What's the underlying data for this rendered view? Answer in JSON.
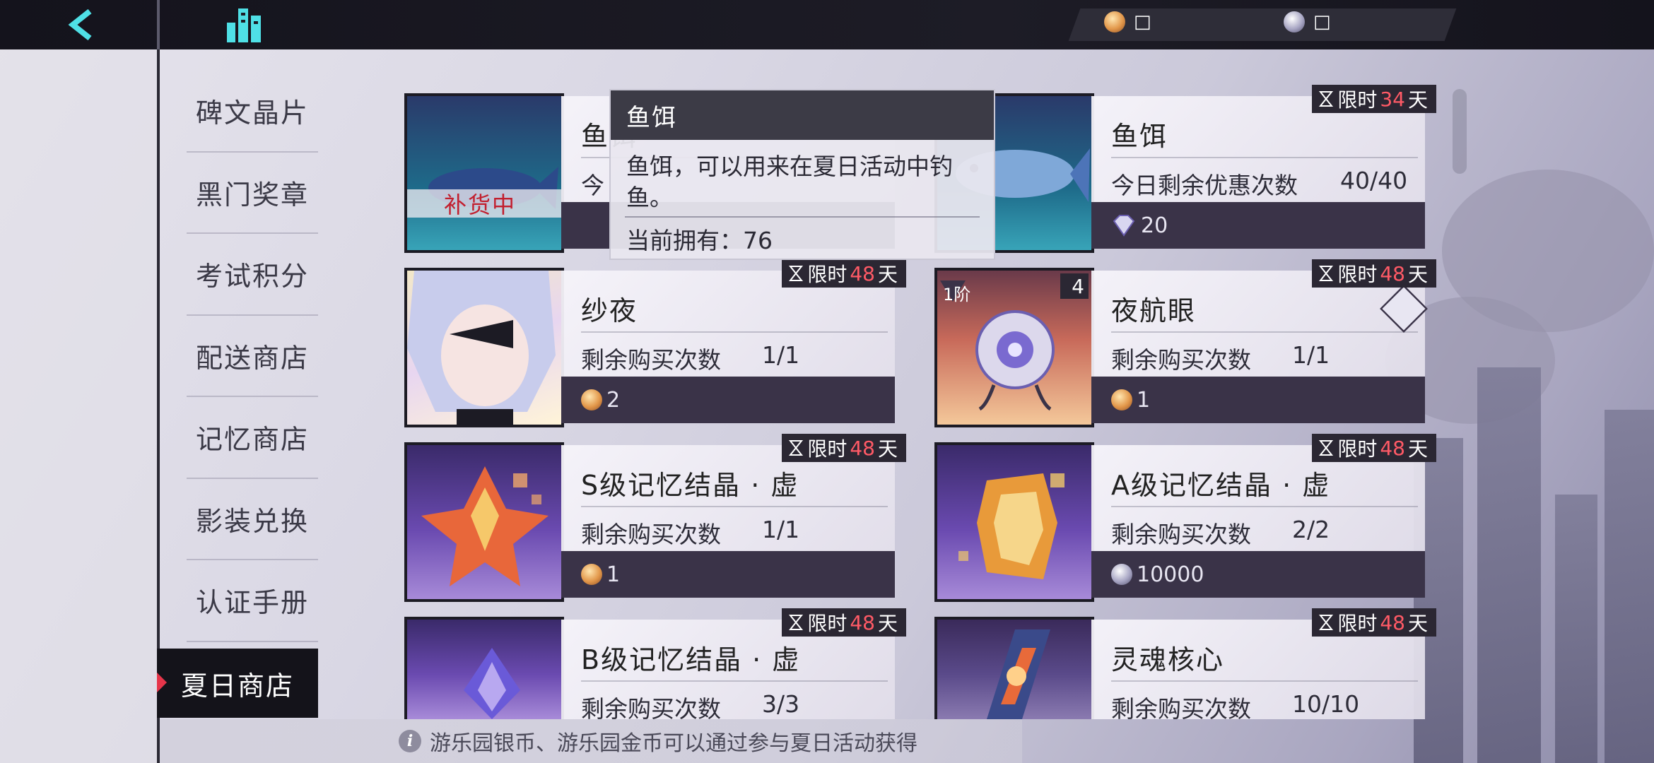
{
  "header": {
    "back_icon": "chevron-left-icon",
    "home_icon": "city-buildings-icon",
    "currencies": [
      {
        "icon": "gold-coin-icon",
        "value": "□"
      },
      {
        "icon": "silver-coin-icon",
        "value": "□"
      }
    ]
  },
  "sidebar": {
    "items": [
      {
        "label": "碑文晶片"
      },
      {
        "label": "黑门奖章"
      },
      {
        "label": "考试积分"
      },
      {
        "label": "配送商店"
      },
      {
        "label": "记忆商店"
      },
      {
        "label": "影装兑换"
      },
      {
        "label": "认证手册"
      }
    ],
    "active": {
      "label": "夏日商店"
    }
  },
  "cards": [
    {
      "name": "鱼饵",
      "remain_label": "今",
      "restock": "补货中"
    },
    {
      "name": "鱼饵",
      "remain_label": "今日剩余优惠次数",
      "remain_count": "40/40",
      "price": "20",
      "currency": "diamond",
      "limit_label": "限时",
      "limit_num": "34",
      "limit_unit": "天"
    },
    {
      "name": "纱夜",
      "remain_label": "剩余购买次数",
      "remain_count": "1/1",
      "price": "2",
      "currency": "gold",
      "limit_label": "限时",
      "limit_num": "48",
      "limit_unit": "天"
    },
    {
      "name": "夜航眼",
      "remain_label": "剩余购买次数",
      "remain_count": "1/1",
      "price": "1",
      "currency": "gold",
      "limit_label": "限时",
      "limit_num": "48",
      "limit_unit": "天",
      "badge_rank": "1阶",
      "badge_count": "4"
    },
    {
      "name": "S级记忆结晶 · 虚",
      "remain_label": "剩余购买次数",
      "remain_count": "1/1",
      "price": "1",
      "currency": "gold",
      "limit_label": "限时",
      "limit_num": "48",
      "limit_unit": "天"
    },
    {
      "name": "A级记忆结晶 · 虚",
      "remain_label": "剩余购买次数",
      "remain_count": "2/2",
      "price": "10000",
      "currency": "silver",
      "limit_label": "限时",
      "limit_num": "48",
      "limit_unit": "天"
    },
    {
      "name": "B级记忆结晶 · 虚",
      "remain_label": "剩余购买次数",
      "remain_count": "3/3",
      "limit_label": "限时",
      "limit_num": "48",
      "limit_unit": "天"
    },
    {
      "name": "灵魂核心",
      "remain_label": "剩余购买次数",
      "remain_count": "10/10",
      "limit_label": "限时",
      "limit_num": "48",
      "limit_unit": "天"
    }
  ],
  "tooltip": {
    "title": "鱼饵",
    "description": "鱼饵，可以用来在夏日活动中钓鱼。",
    "owned": "当前拥有：76"
  },
  "footer": {
    "info_icon": "info-icon",
    "text": "游乐园银币、游乐园金币可以通过参与夏日活动获得"
  },
  "colors": {
    "accent_red": "#e6354a",
    "limit_red": "#ff5a66",
    "dark": "#14131a"
  }
}
